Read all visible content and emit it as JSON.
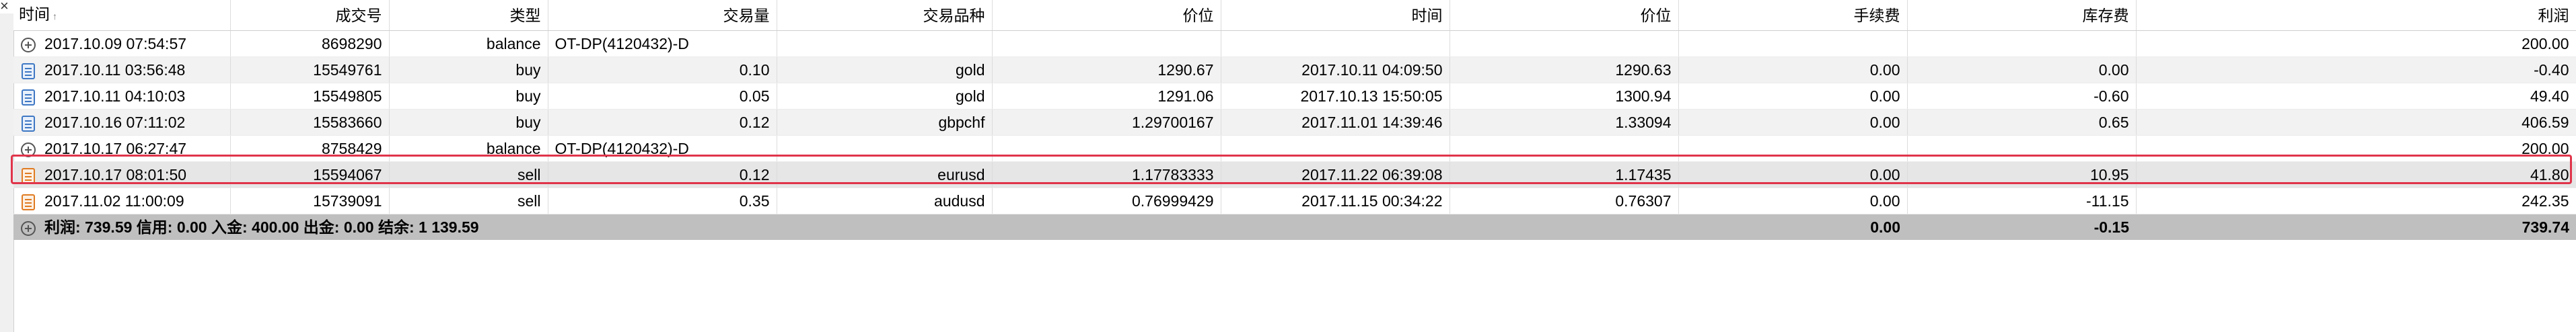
{
  "headers": {
    "time": "时间",
    "ticket": "成交号",
    "type": "类型",
    "volume": "交易量",
    "symbol": "交易品种",
    "price": "价位",
    "close_time": "时间",
    "close_price": "价位",
    "commission": "手续费",
    "swap": "库存费",
    "profit": "利润"
  },
  "rows": [
    {
      "icon": "plus-icon",
      "time": "2017.10.09 07:54:57",
      "ticket": "8698290",
      "type": "balance",
      "volume": "OT-DP(4120432)-D",
      "symbol": "",
      "price": "",
      "close_time": "",
      "close_price": "",
      "commission": "",
      "swap": "",
      "profit": "200.00"
    },
    {
      "icon": "deal-doc-icon",
      "time": "2017.10.11 03:56:48",
      "ticket": "15549761",
      "type": "buy",
      "volume": "0.10",
      "symbol": "gold",
      "price": "1290.67",
      "close_time": "2017.10.11 04:09:50",
      "close_price": "1290.63",
      "commission": "0.00",
      "swap": "0.00",
      "profit": "-0.40"
    },
    {
      "icon": "deal-doc-icon",
      "time": "2017.10.11 04:10:03",
      "ticket": "15549805",
      "type": "buy",
      "volume": "0.05",
      "symbol": "gold",
      "price": "1291.06",
      "close_time": "2017.10.13 15:50:05",
      "close_price": "1300.94",
      "commission": "0.00",
      "swap": "-0.60",
      "profit": "49.40"
    },
    {
      "icon": "deal-doc-icon",
      "time": "2017.10.16 07:11:02",
      "ticket": "15583660",
      "type": "buy",
      "volume": "0.12",
      "symbol": "gbpchf",
      "price": "1.29700167",
      "close_time": "2017.11.01 14:39:46",
      "close_price": "1.33094",
      "commission": "0.00",
      "swap": "0.65",
      "profit": "406.59"
    },
    {
      "icon": "plus-icon",
      "time": "2017.10.17 06:27:47",
      "ticket": "8758429",
      "type": "balance",
      "volume": "OT-DP(4120432)-D",
      "symbol": "",
      "price": "",
      "close_time": "",
      "close_price": "",
      "commission": "",
      "swap": "",
      "profit": "200.00"
    },
    {
      "icon": "sell-doc-icon",
      "time": "2017.10.17 08:01:50",
      "ticket": "15594067",
      "type": "sell",
      "volume": "0.12",
      "symbol": "eurusd",
      "price": "1.17783333",
      "close_time": "2017.11.22 06:39:08",
      "close_price": "1.17435",
      "commission": "0.00",
      "swap": "10.95",
      "profit": "41.80"
    },
    {
      "icon": "sell-doc-icon",
      "time": "2017.11.02 11:00:09",
      "ticket": "15739091",
      "type": "sell",
      "volume": "0.35",
      "symbol": "audusd",
      "price": "0.76999429",
      "close_time": "2017.11.15 00:34:22",
      "close_price": "0.76307",
      "commission": "0.00",
      "swap": "-11.15",
      "profit": "242.35"
    }
  ],
  "summary": {
    "text": "利润: 739.59  信用: 0.00  入金: 400.00  出金: 0.00  结余: 1 139.59",
    "commission": "0.00",
    "swap": "-0.15",
    "profit": "739.74"
  },
  "accent_colors": {
    "highlight": "#e0344a",
    "buy_icon": "#3f78c4",
    "sell_icon": "#e07b22"
  }
}
